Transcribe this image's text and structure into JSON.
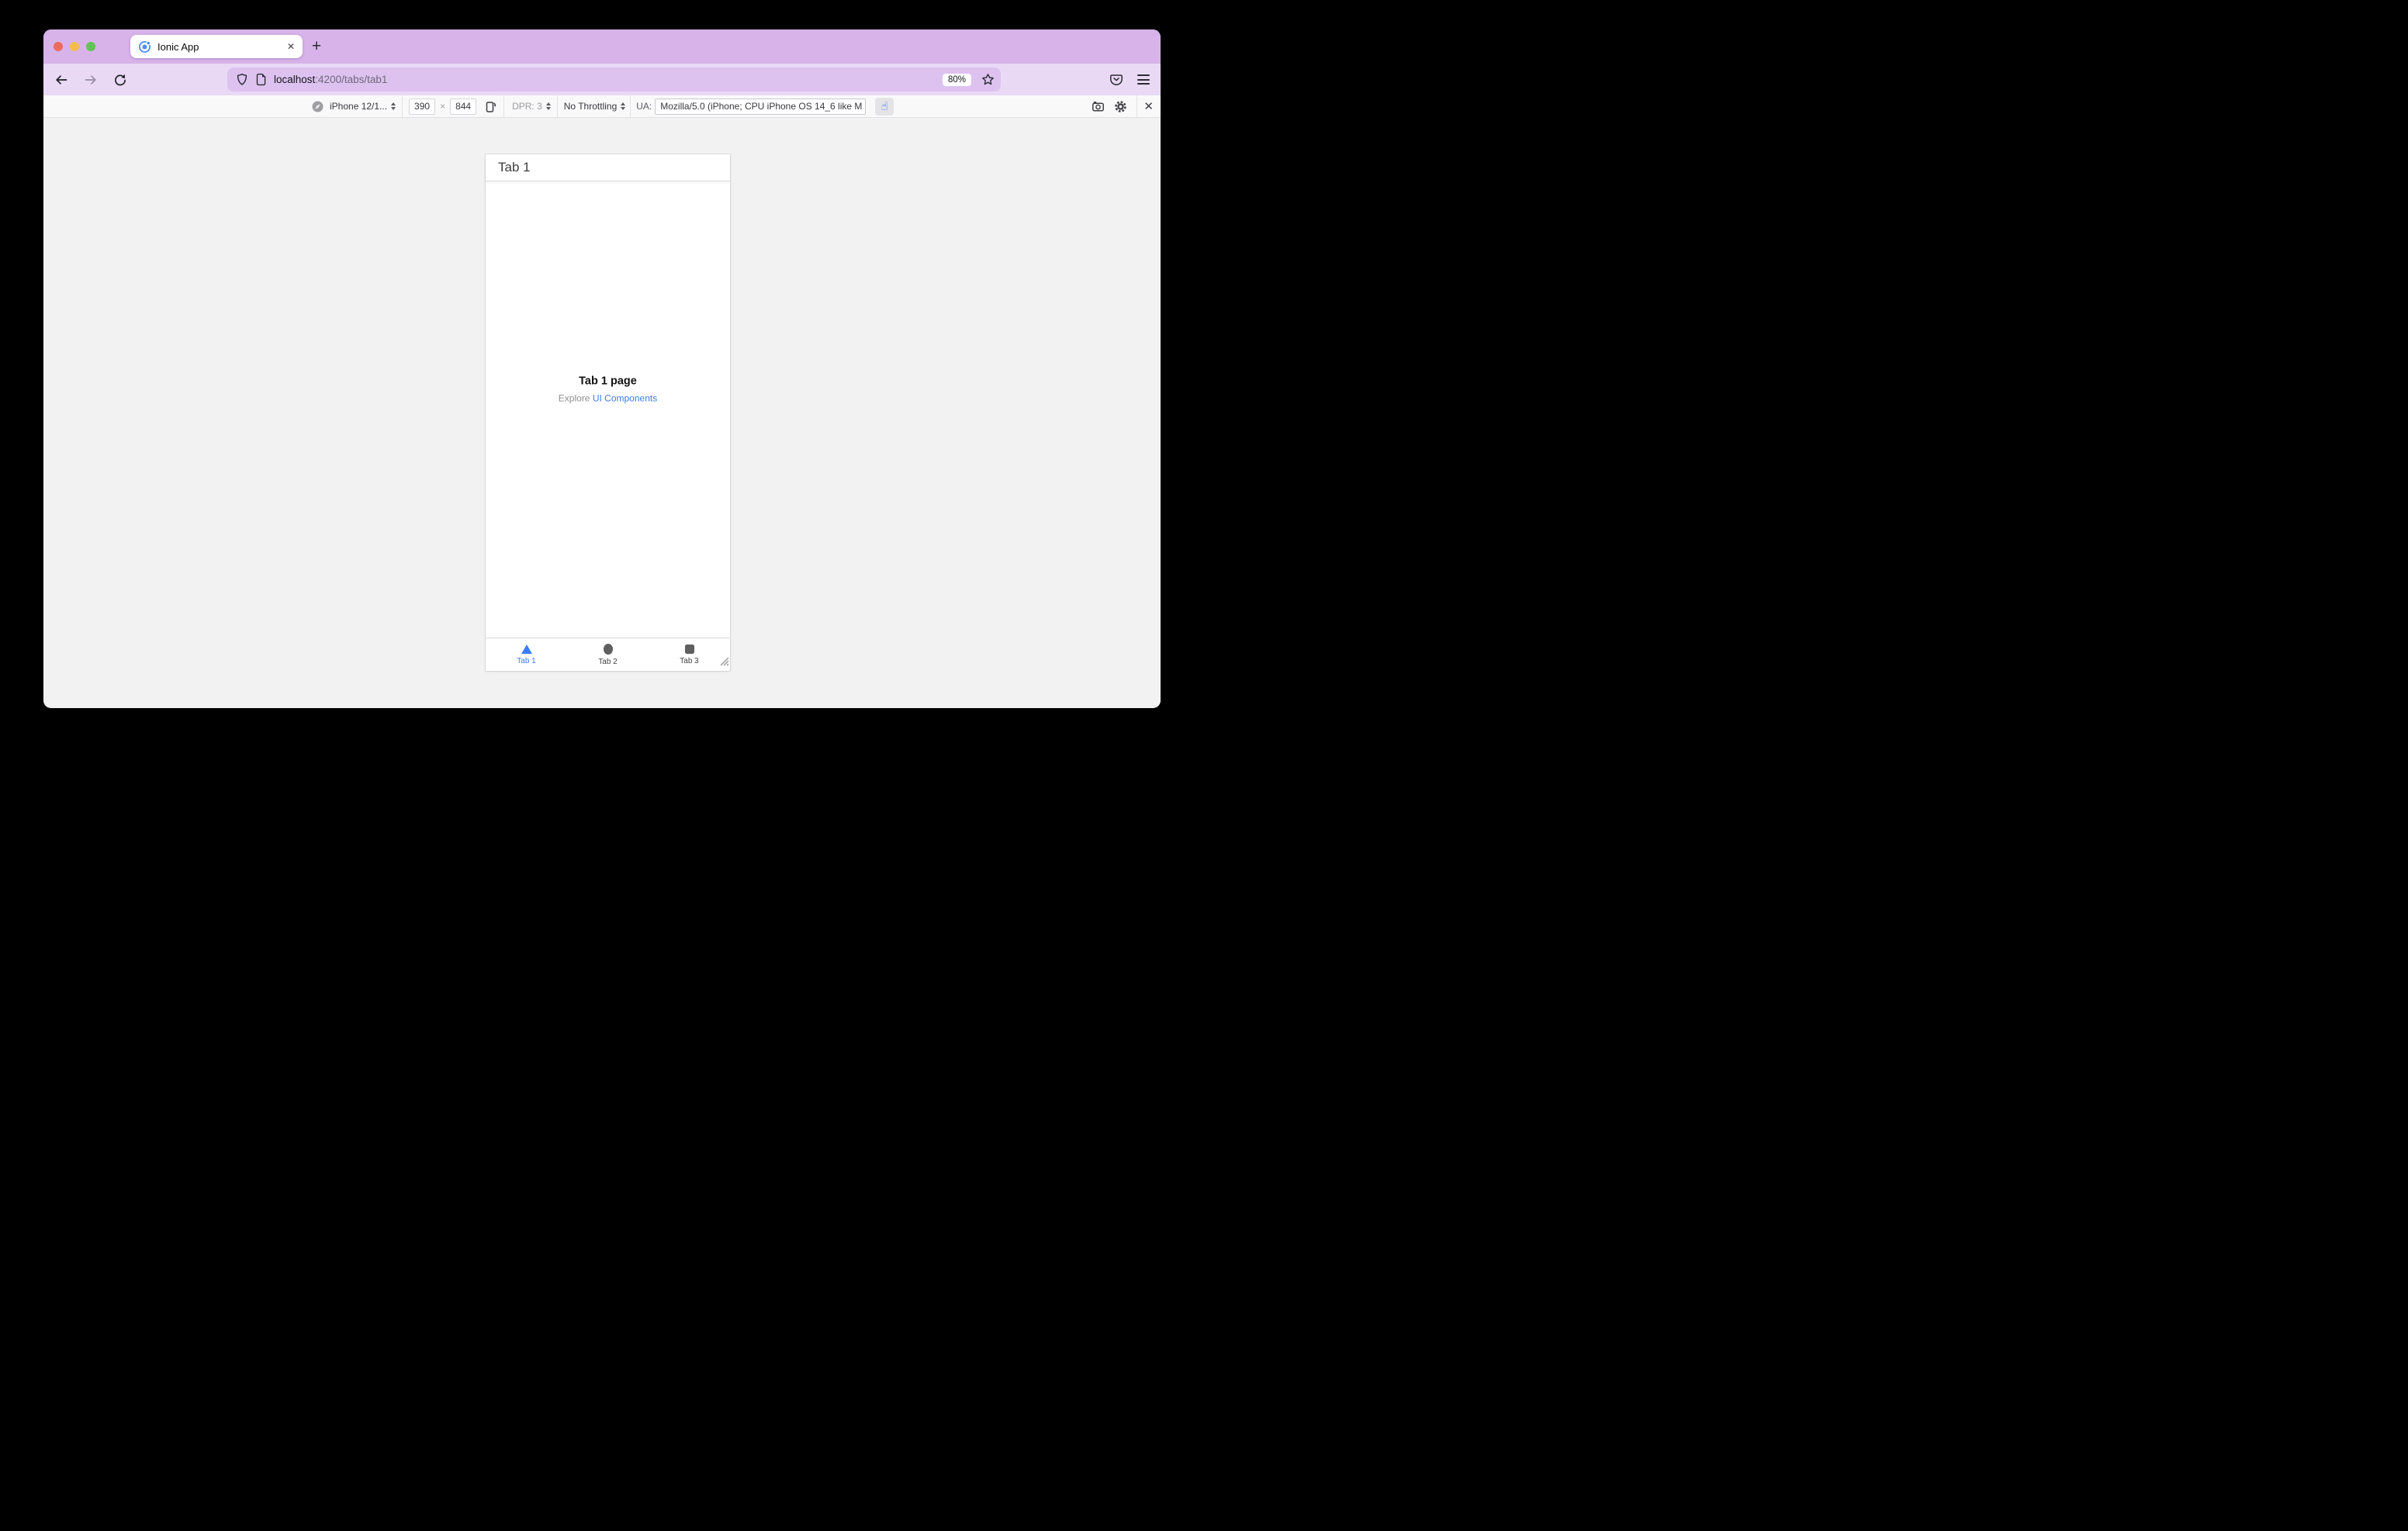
{
  "window": {
    "tab": {
      "title": "Ionic App",
      "close_glyph": "✕",
      "new_tab_glyph": "+"
    },
    "navbar": {
      "url_host": "localhost",
      "url_path": ":4200/tabs/tab1",
      "zoom_badge": "80%"
    },
    "rdm": {
      "device": "iPhone 12/1...",
      "viewport_width": "390",
      "times_glyph": "×",
      "viewport_height": "844",
      "dpr": "DPR: 3",
      "throttling": "No Throttling",
      "ua_label": "UA:",
      "ua_value": "Mozilla/5.0 (iPhone; CPU iPhone OS 14_6 like M",
      "touch_glyph": "☝",
      "close_glyph": "✕"
    },
    "phone": {
      "header_title": "Tab 1",
      "page_title": "Tab 1 page",
      "subtitle_prefix": "Explore ",
      "subtitle_link": "UI Components",
      "tabs": [
        {
          "label": "Tab 1",
          "active": true
        },
        {
          "label": "Tab 2",
          "active": false
        },
        {
          "label": "Tab 3",
          "active": false
        }
      ]
    },
    "colors": {
      "accent_blue": "#3b7dff",
      "tabstrip_bg": "#d7b3e9",
      "toolbar_bg": "#e9d9f5",
      "urlbar_bg": "#ddc2f0",
      "rdm_bg": "#f9f9fa",
      "content_bg": "#f2f2f3"
    }
  }
}
